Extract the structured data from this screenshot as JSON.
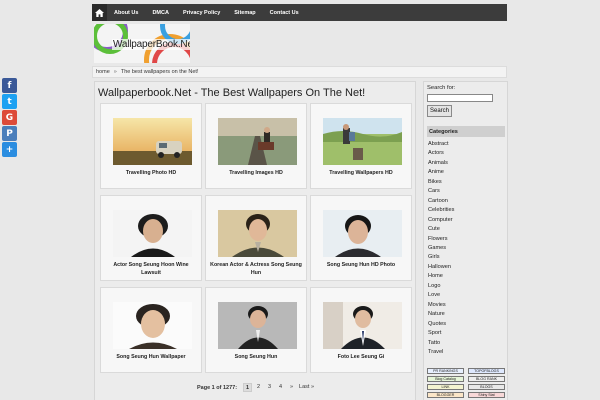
{
  "nav": {
    "items": [
      {
        "label": "About Us",
        "name": "nav-about-us"
      },
      {
        "label": "DMCA",
        "name": "nav-dmca"
      },
      {
        "label": "Privacy Policy",
        "name": "nav-privacy-policy"
      },
      {
        "label": "Sitemap",
        "name": "nav-sitemap"
      },
      {
        "label": "Contact Us",
        "name": "nav-contact-us"
      }
    ]
  },
  "logo": {
    "text": "WallpaperBook.Net"
  },
  "breadcrumb": {
    "home": "home",
    "separator": "»",
    "current": "The best wallpapers on the Net!"
  },
  "main": {
    "title": "Wallpaperbook.Net - The Best Wallpapers On The Net!",
    "cards": [
      {
        "caption": "Travelling Photo HD",
        "theme": "van"
      },
      {
        "caption": "Travelling Images HD",
        "theme": "road"
      },
      {
        "caption": "Travelling Wallpapers HD",
        "theme": "hiker"
      },
      {
        "caption": "Actor Song Seung Hoon Wine Lawsuit",
        "theme": "portrait-dark"
      },
      {
        "caption": "Korean Actor & Actress Song Seung Hun",
        "theme": "portrait-warm"
      },
      {
        "caption": "Song Seung Hun HD Photo",
        "theme": "portrait-light"
      },
      {
        "caption": "Song Seung Hun Wallpaper",
        "theme": "portrait-pale"
      },
      {
        "caption": "Song Seung Hun",
        "theme": "portrait-grey"
      },
      {
        "caption": "Foto Lee Seung Gi",
        "theme": "portrait-suit"
      }
    ],
    "pagination": {
      "info": "Page 1 of 1277:",
      "pages": [
        "1",
        "2",
        "3",
        "4"
      ],
      "current": "1",
      "next": "»",
      "last": "Last »"
    }
  },
  "sidebar": {
    "search_label": "Search for:",
    "search_value": "",
    "search_button": "Search",
    "categories_heading": "Categories",
    "categories": [
      "Abstract",
      "Actors",
      "Animals",
      "Anime",
      "Bikes",
      "Cars",
      "Cartoon",
      "Celebrities",
      "Computer",
      "Cute",
      "Flowers",
      "Games",
      "Girls",
      "Hallowen",
      "Home",
      "Logo",
      "Love",
      "Movies",
      "Nature",
      "Quotes",
      "Sport",
      "Tatto",
      "Travel"
    ],
    "badges": [
      "PR RANKINGS",
      "TOPOFBLOGS",
      "Blog Catalog",
      "BLOG RANK",
      "LINK",
      "BLOGS",
      "BLOGGER",
      "Shiny Stat"
    ]
  },
  "share": {
    "buttons": [
      {
        "icon": "facebook-icon",
        "color": "#3b5998",
        "glyph": "f"
      },
      {
        "icon": "twitter-icon",
        "color": "#1da1f2",
        "glyph": "t"
      },
      {
        "icon": "google-plus-icon",
        "color": "#dd4b39",
        "glyph": "G"
      },
      {
        "icon": "print-icon",
        "color": "#4a7ebb",
        "glyph": "P"
      },
      {
        "icon": "share-icon",
        "color": "#2b8de0",
        "glyph": "+"
      }
    ]
  }
}
